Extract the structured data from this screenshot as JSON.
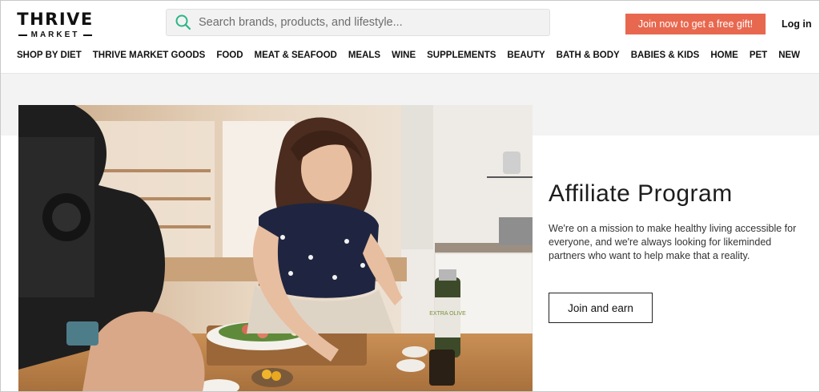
{
  "header": {
    "logo_top": "THRIVE",
    "logo_bottom": "MARKET",
    "search_placeholder": "Search brands, products, and lifestyle...",
    "join_label": "Join now to get a free gift!",
    "login_label": "Log in",
    "accent_color": "#e8684f"
  },
  "nav": {
    "items": [
      "SHOP BY DIET",
      "THRIVE MARKET GOODS",
      "FOOD",
      "MEAT & SEAFOOD",
      "MEALS",
      "WINE",
      "SUPPLEMENTS",
      "BEAUTY",
      "BATH & BODY",
      "BABIES & KIDS",
      "HOME",
      "PET",
      "NEW"
    ]
  },
  "hero": {
    "title": "Affiliate Program",
    "description": "We're on a mission to make healthy living accessible for everyone, and we're always looking for likeminded partners who want to help make that a reality.",
    "cta_label": "Join and earn",
    "bottle_label": "EXTRA OLIVE"
  }
}
